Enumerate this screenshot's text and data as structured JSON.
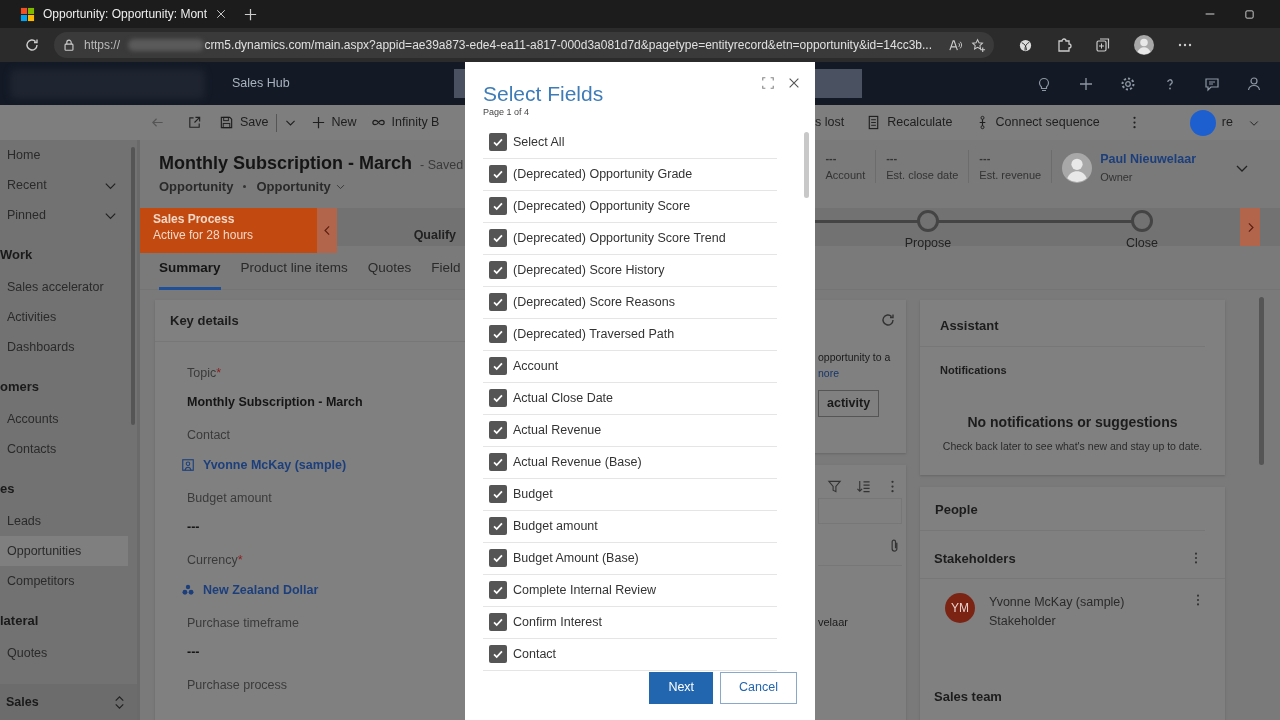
{
  "browser": {
    "tab_title": "Opportunity: Opportunity: Mont",
    "url_scheme": "https://",
    "url": "crm5.dynamics.com/main.aspx?appid=ae39a873-ede4-ea11-a817-000d3a081d7d&pagetype=entityrecord&etn=opportunity&id=14cc3b..."
  },
  "app": {
    "title": "Sales Hub"
  },
  "commands_left": [
    {
      "kind": "save",
      "label": "Save"
    },
    {
      "kind": "new",
      "label": "New"
    },
    {
      "kind": "infinity",
      "label": "Infinity B"
    }
  ],
  "commands_right": [
    {
      "kind": "plain",
      "label": "s lost"
    },
    {
      "kind": "recalculate",
      "label": "Recalculate"
    },
    {
      "kind": "sequence",
      "label": "Connect sequence"
    },
    {
      "kind": "share",
      "label": "re"
    }
  ],
  "nav": [
    {
      "kind": "item",
      "label": "Home",
      "expandable": false,
      "selected": false
    },
    {
      "kind": "item",
      "label": "Recent",
      "expandable": true,
      "selected": false
    },
    {
      "kind": "item",
      "label": "Pinned",
      "expandable": true,
      "selected": false
    },
    {
      "kind": "group",
      "label": "Work"
    },
    {
      "kind": "item",
      "label": "Sales accelerator",
      "expandable": false,
      "selected": false
    },
    {
      "kind": "item",
      "label": "Activities",
      "expandable": false,
      "selected": false
    },
    {
      "kind": "item",
      "label": "Dashboards",
      "expandable": false,
      "selected": false
    },
    {
      "kind": "group",
      "label": "omers"
    },
    {
      "kind": "item",
      "label": "Accounts",
      "expandable": false,
      "selected": false
    },
    {
      "kind": "item",
      "label": "Contacts",
      "expandable": false,
      "selected": false
    },
    {
      "kind": "group",
      "label": "es"
    },
    {
      "kind": "item",
      "label": "Leads",
      "expandable": false,
      "selected": false
    },
    {
      "kind": "item",
      "label": "Opportunities",
      "expandable": false,
      "selected": true
    },
    {
      "kind": "item",
      "label": "Competitors",
      "expandable": false,
      "selected": false
    },
    {
      "kind": "group",
      "label": "lateral"
    },
    {
      "kind": "item",
      "label": "Quotes",
      "expandable": false,
      "selected": false
    }
  ],
  "area_switcher": {
    "label": "Sales"
  },
  "record": {
    "title": "Monthly Subscription - March",
    "status": "- Saved",
    "entity": "Opportunity",
    "form": "Opportunity",
    "header_fields": [
      {
        "value": "---",
        "label": "Account"
      },
      {
        "value": "---",
        "label": "Est. close date"
      },
      {
        "value": "---",
        "label": "Est. revenue"
      }
    ],
    "owner": {
      "name": "Paul Nieuwelaar",
      "role": "Owner"
    }
  },
  "process": {
    "name": "Sales Process",
    "duration": "Active for 28 hours",
    "stages": [
      {
        "label": "Qualify",
        "active": true
      },
      {
        "label": "Propose",
        "active": false
      },
      {
        "label": "Close",
        "active": false
      }
    ]
  },
  "tabs": [
    {
      "label": "Summary",
      "selected": true
    },
    {
      "label": "Product line items",
      "selected": false
    },
    {
      "label": "Quotes",
      "selected": false
    },
    {
      "label": "Field",
      "selected": false
    }
  ],
  "key_details": {
    "title": "Key details",
    "fields": [
      {
        "label": "Topic",
        "required_mark": "*",
        "kind": "text",
        "value": "Monthly Subscription - March"
      },
      {
        "label": "Contact",
        "kind": "contact",
        "value": "Yvonne McKay (sample)"
      },
      {
        "label": "Budget amount",
        "kind": "text",
        "value": "---"
      },
      {
        "label": "Currency",
        "required_mark": "*",
        "kind": "currency",
        "value": "New Zealand Dollar"
      },
      {
        "label": "Purchase timeframe",
        "kind": "text",
        "value": "---"
      },
      {
        "label": "Purchase process",
        "kind": "label_only"
      }
    ]
  },
  "timeline": {
    "text": "opportunity to a",
    "link": "nore",
    "button": "activity",
    "owner_text": "velaar"
  },
  "assistant": {
    "title": "Assistant",
    "section": "Notifications",
    "empty_title": "No notifications or suggestions",
    "empty_text": "Check back later to see what's new and stay up to date."
  },
  "people": {
    "title": "People",
    "stakeholders_title": "Stakeholders",
    "stakeholders": [
      {
        "initials": "YM",
        "name": "Yvonne McKay (sample)",
        "role": "Stakeholder"
      }
    ],
    "sales_team_title": "Sales team"
  },
  "dialog": {
    "title": "Select Fields",
    "page": "Page 1 of 4",
    "select_all": {
      "label": "Select All",
      "checked": true
    },
    "fields": [
      {
        "label": "(Deprecated) Opportunity Grade",
        "checked": true
      },
      {
        "label": "(Deprecated) Opportunity Score",
        "checked": true
      },
      {
        "label": "(Deprecated) Opportunity Score Trend",
        "checked": true
      },
      {
        "label": "(Deprecated) Score History",
        "checked": true
      },
      {
        "label": "(Deprecated) Score Reasons",
        "checked": true
      },
      {
        "label": "(Deprecated) Traversed Path",
        "checked": true
      },
      {
        "label": "Account",
        "checked": true
      },
      {
        "label": "Actual Close Date",
        "checked": true
      },
      {
        "label": "Actual Revenue",
        "checked": true
      },
      {
        "label": "Actual Revenue (Base)",
        "checked": true
      },
      {
        "label": "Budget",
        "checked": true
      },
      {
        "label": "Budget amount",
        "checked": true
      },
      {
        "label": "Budget Amount (Base)",
        "checked": true
      },
      {
        "label": "Complete Internal Review",
        "checked": true
      },
      {
        "label": "Confirm Interest",
        "checked": true
      },
      {
        "label": "Contact",
        "checked": true
      }
    ],
    "buttons": [
      {
        "kind": "primary",
        "label": "Next"
      },
      {
        "kind": "secondary",
        "label": "Cancel"
      }
    ]
  }
}
